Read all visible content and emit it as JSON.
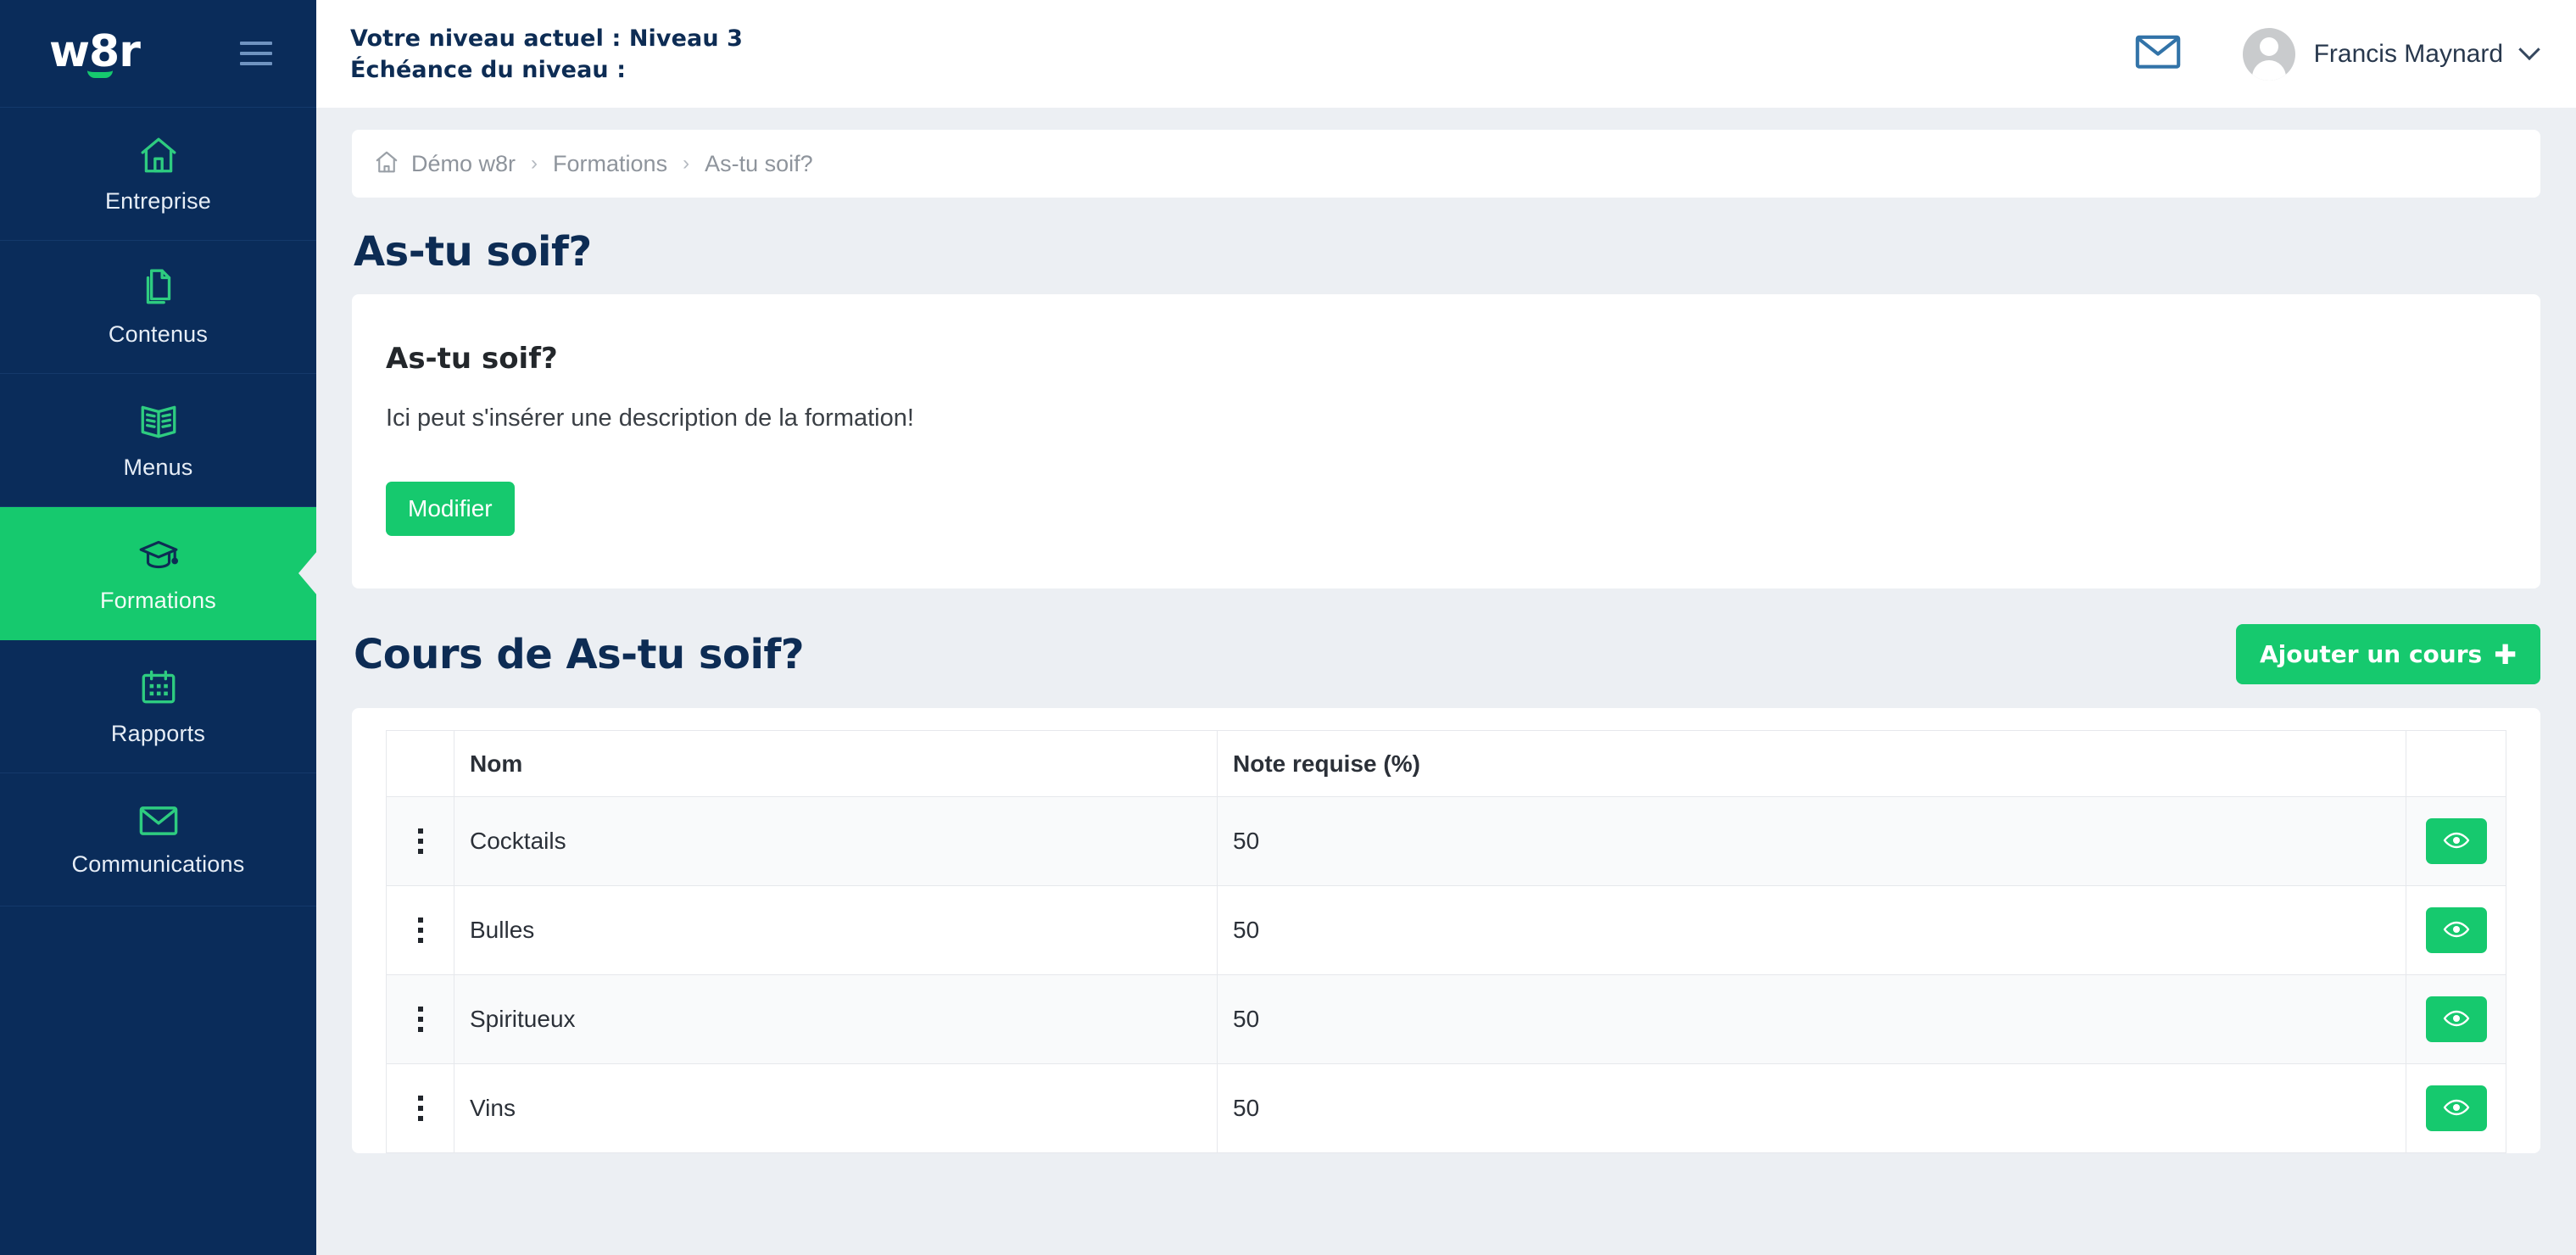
{
  "brand": {
    "logo_text": "w8r",
    "accent_green": "#16c96e",
    "navy": "#0a2c5a",
    "page_bg": "#eceff3"
  },
  "sidebar": {
    "items": [
      {
        "label": "Entreprise",
        "icon": "home-icon",
        "active": false
      },
      {
        "label": "Contenus",
        "icon": "documents-icon",
        "active": false
      },
      {
        "label": "Menus",
        "icon": "book-icon",
        "active": false
      },
      {
        "label": "Formations",
        "icon": "graduation-cap-icon",
        "active": true
      },
      {
        "label": "Rapports",
        "icon": "calendar-icon",
        "active": false
      },
      {
        "label": "Communications",
        "icon": "envelope-icon",
        "active": false
      }
    ]
  },
  "topbar": {
    "level_current": "Votre niveau actuel : Niveau 3",
    "level_due": "Échéance du niveau :",
    "mail_icon": "envelope-icon",
    "user_name": "Francis Maynard",
    "chevron": "chevron-down-icon"
  },
  "breadcrumb": {
    "home_icon": "home-icon",
    "items": [
      "Démo w8r",
      "Formations",
      "As-tu soif?"
    ],
    "separator": "›"
  },
  "page": {
    "title": "As-tu soif?"
  },
  "info_card": {
    "title": "As-tu soif?",
    "description": "Ici peut s'insérer une description de la formation!",
    "edit_button": "Modifier"
  },
  "courses_section": {
    "title": "Cours de As-tu soif?",
    "add_button": "Ajouter un cours",
    "add_button_icon": "plus-icon",
    "table": {
      "columns": [
        "",
        "Nom",
        "Note requise (%)",
        ""
      ],
      "rows": [
        {
          "menu": "kebab-menu-icon",
          "name": "Cocktails",
          "note": "50",
          "action": "eye-icon"
        },
        {
          "menu": "kebab-menu-icon",
          "name": "Bulles",
          "note": "50",
          "action": "eye-icon"
        },
        {
          "menu": "kebab-menu-icon",
          "name": "Spiritueux",
          "note": "50",
          "action": "eye-icon"
        },
        {
          "menu": "kebab-menu-icon",
          "name": "Vins",
          "note": "50",
          "action": "eye-icon"
        }
      ]
    }
  }
}
